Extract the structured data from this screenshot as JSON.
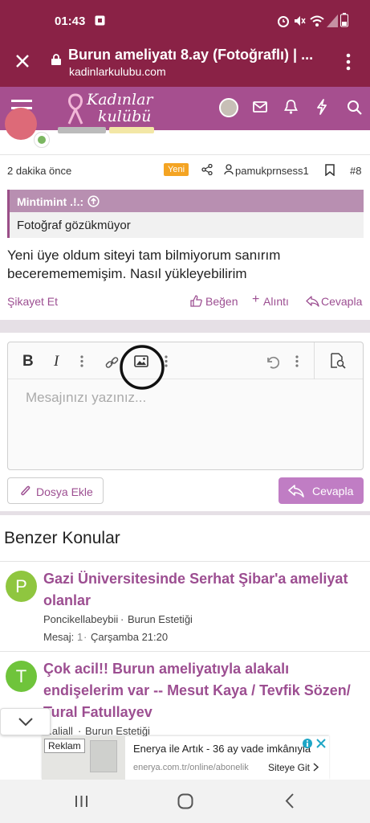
{
  "status": {
    "time": "01:43"
  },
  "browser": {
    "title": "Burun ameliyatı 8.ay (Fotoğraflı) | ...",
    "domain": "kadinlarkulubu.com"
  },
  "site": {
    "logo_line1": "Kadınlar",
    "logo_line2": "kulübü"
  },
  "post": {
    "time_ago": "2 dakika önce",
    "new_badge": "Yeni",
    "author": "pamukprnsess1",
    "number": "#8",
    "quote_author": "Mintimint .!.:",
    "quote_text": "Fotoğraf gözükmüyor",
    "body": "Yeni üye oldum siteyi tam bilmiyorum sanırım beceremememişim. Nasıl yükleyebilirim",
    "report": "Şikayet Et",
    "like": "Beğen",
    "quote": "Alıntı",
    "reply": "Cevapla"
  },
  "editor": {
    "placeholder": "Mesajınızı yazınız...",
    "attach": "Dosya Ekle",
    "submit": "Cevapla"
  },
  "similar": {
    "title": "Benzer Konular",
    "threads": [
      {
        "avatar_letter": "P",
        "avatar_color": "#8fc63f",
        "title_line1": "Gazi Üniversitesinde Serhat Şibar'a ameliyat",
        "title_line2": "olanlar",
        "author": "Poncikellabeybii",
        "forum": "Burun Estetiği",
        "msg_label": "Mesaj:",
        "msg_count": "1",
        "date": "Çarşamba 21:20"
      },
      {
        "avatar_letter": "T",
        "avatar_color": "#6fc43b",
        "title_line1": "Çok acil!! Burun ameliyatıyla alakalı",
        "title_line2": "endişelerim var -- Mesut Kaya / Tevfik Sözen/",
        "title_line3": "Tural Fatullayev",
        "author": "...aliall",
        "forum": "Burun Estetiği"
      }
    ]
  },
  "ad": {
    "label": "Reklam",
    "headline": "Enerya ile Artık - 36 ay vade imkânıyla",
    "url": "enerya.com.tr/online/abonelik",
    "cta": "Siteye Git"
  }
}
